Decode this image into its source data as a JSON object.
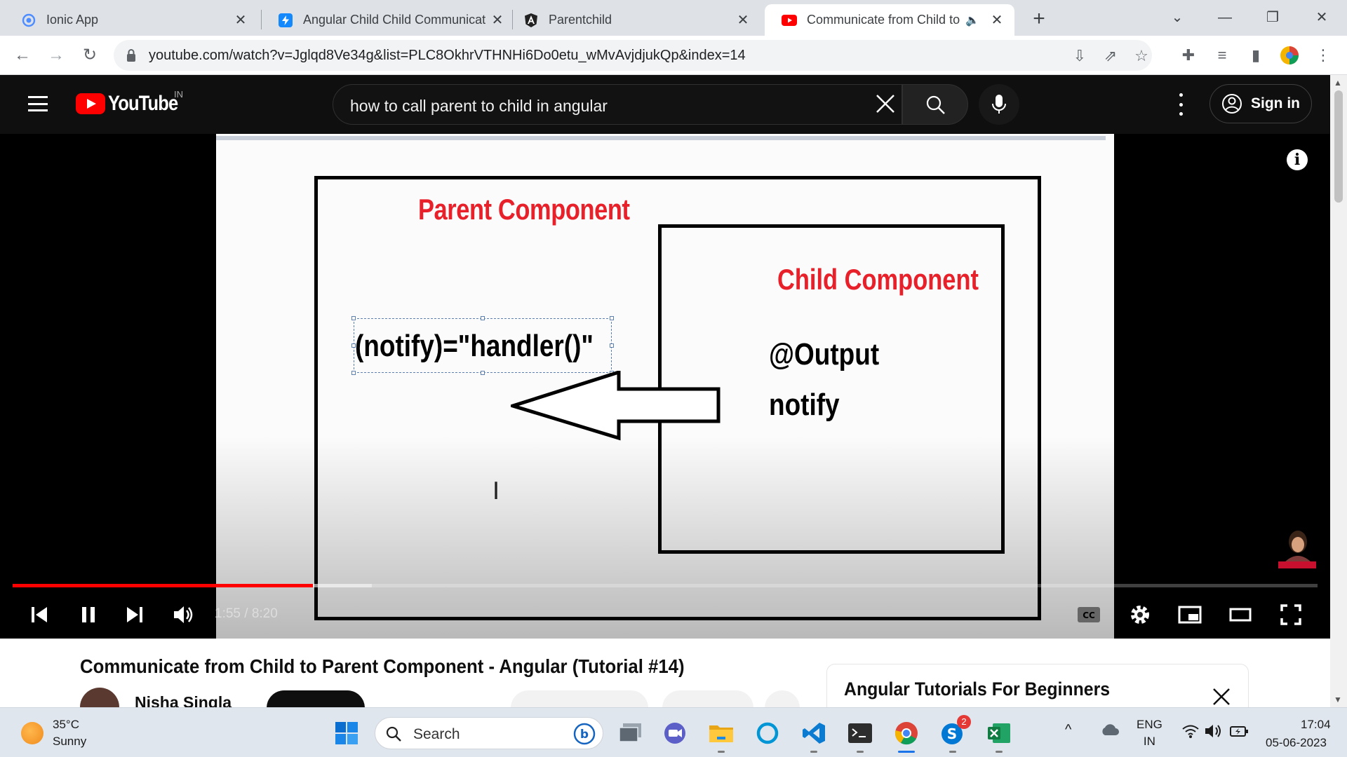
{
  "browser": {
    "tabs": [
      {
        "title": "Ionic App",
        "close": "✕"
      },
      {
        "title": "Angular Child Child Communicat",
        "close": "✕"
      },
      {
        "title": "Parentchild",
        "close": "✕"
      },
      {
        "title": "Communicate from Child to",
        "close": "✕"
      }
    ],
    "new_tab": "+",
    "url": "youtube.com/watch?v=Jglqd8Ve34g&list=PLC8OkhrVTHNHi6Do0etu_wMvAvjdjukQp&index=14"
  },
  "youtube": {
    "logo_text": "YouTube",
    "country_code": "IN",
    "search_query": "how to call parent to child in angular",
    "sign_in_label": "Sign in"
  },
  "player": {
    "slide": {
      "parent_title": "Parent Component",
      "child_title": "Child Component",
      "handler_code": "(notify)=\"handler()\"",
      "output_decorator": "@Output",
      "output_name": "notify"
    },
    "time_display": "1:55 / 8:20",
    "played_fraction": 0.23,
    "buffered_fraction": 0.275,
    "info_glyph": "i"
  },
  "video": {
    "title": "Communicate from Child to Parent Component - Angular (Tutorial #14)",
    "channel_name": "Nisha Singla"
  },
  "playlist": {
    "title": "Angular Tutorials For Beginners"
  },
  "taskbar": {
    "weather_temp": "35°C",
    "weather_desc": "Sunny",
    "search_label": "Search",
    "skype_badge": "2",
    "language": "ENG",
    "region": "IN",
    "time": "17:04",
    "date": "05-06-2023"
  },
  "colors": {
    "youtube_red": "#ff0000",
    "slide_title_red": "#e8202a",
    "masthead_bg": "#0f0f0f",
    "chrome_tabstrip": "#dee1e6"
  }
}
